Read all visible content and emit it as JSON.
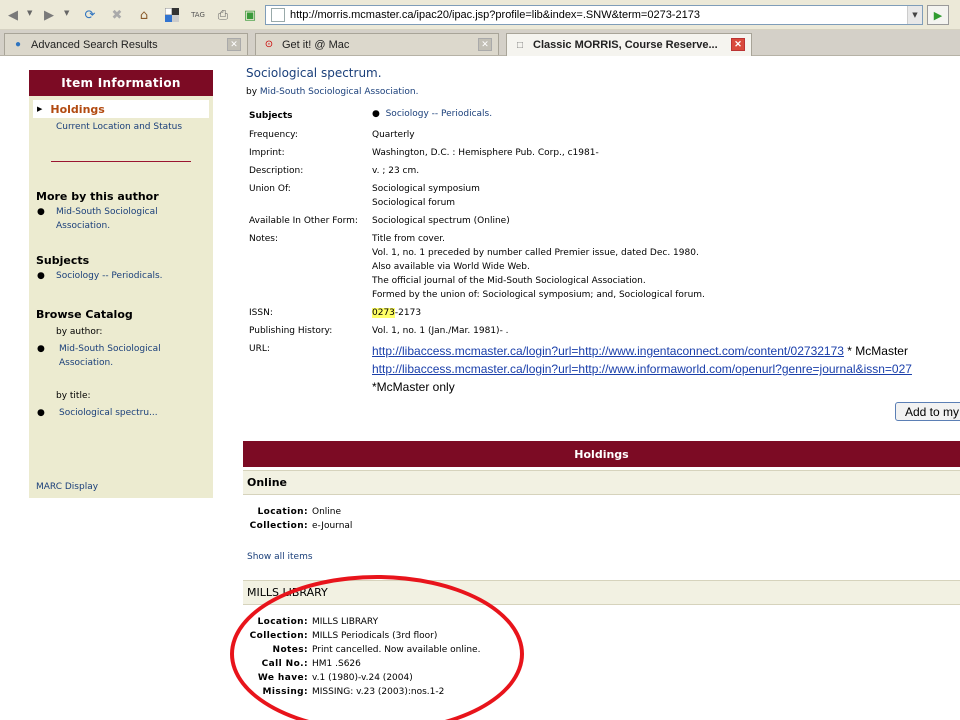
{
  "browser": {
    "address": "http://morris.mcmaster.ca/ipac20/ipac.jsp?profile=lib&index=.SNW&term=0273-2173",
    "tabs": [
      {
        "label": "Advanced Search Results"
      },
      {
        "label": "Get it! @ Mac"
      },
      {
        "label": "Classic MORRIS, Course Reserve..."
      }
    ],
    "toolbar_icons": [
      "back-icon",
      "forward-icon",
      "refresh-icon",
      "stop-icon",
      "home-icon",
      "delicious-icon",
      "tag-icon",
      "print-icon",
      "new-tab-icon"
    ]
  },
  "sidebar": {
    "header": "Item Information",
    "holdings": "Holdings",
    "current_location": "Current Location and Status",
    "more_by_author": "More by this author",
    "author_link_1": "Mid-South Sociological",
    "author_link_2": "Association.",
    "subjects_title": "Subjects",
    "subjects_link": "Sociology -- Periodicals.",
    "browse_title": "Browse Catalog",
    "by_author": "by author:",
    "browse_author_1": "Mid-South Sociological",
    "browse_author_2": "Association.",
    "by_title": "by title:",
    "browse_title_link": "Sociological spectru...",
    "marc": "MARC Display"
  },
  "record": {
    "title": "Sociological spectrum.",
    "by_prefix": "by",
    "by_link": "Mid-South Sociological Association.",
    "subjects_label": "Subjects",
    "subjects_value": "Sociology -- Periodicals.",
    "frequency_label": "Frequency:",
    "frequency_value": "Quarterly",
    "imprint_label": "Imprint:",
    "imprint_value": "Washington, D.C. : Hemisphere Pub. Corp., c1981-",
    "description_label": "Description:",
    "description_value": "v. ; 23 cm.",
    "union_label": "Union Of:",
    "union_1": "Sociological symposium",
    "union_2": "Sociological forum",
    "available_label": "Available In Other Form:",
    "available_value": "Sociological spectrum (Online)",
    "notes_label": "Notes:",
    "notes_1": "Title from cover.",
    "notes_2": "Vol. 1, no. 1 preceded by number called Premier issue, dated Dec. 1980.",
    "notes_3": "Also available via World Wide Web.",
    "notes_4": "The official journal of the Mid-South Sociological Association.",
    "notes_5": "Formed by the union of: Sociological symposium; and, Sociological forum.",
    "issn_label": "ISSN:",
    "issn_highlight": "0273",
    "issn_rest": "-2173",
    "pubhist_label": "Publishing History:",
    "pubhist_value": "Vol. 1, no. 1 (Jan./Mar. 1981)- .",
    "url_label": "URL:",
    "url_1": "http://libaccess.mcmaster.ca/login?url=http://www.ingentaconnect.com/content/02732173",
    "url_1_suffix": " * McMaster",
    "url_2": "http://libaccess.mcmaster.ca/login?url=http://www.informaworld.com/openurl?genre=journal&issn=027",
    "url_3": "*McMaster only",
    "add_button": "Add to my"
  },
  "holdings": {
    "bar": "Holdings",
    "online_head": "Online",
    "online_location_label": "Location:",
    "online_location": "Online",
    "online_collection_label": "Collection:",
    "online_collection": "e-Journal",
    "show_all": "Show all items",
    "mills_head": "MILLS LIBRARY",
    "m_location_label": "Location:",
    "m_location": "MILLS LIBRARY",
    "m_collection_label": "Collection:",
    "m_collection": "MILLS Periodicals (3rd floor)",
    "m_notes_label": "Notes:",
    "m_notes": "Print cancelled. Now available online.",
    "m_callno_label": "Call No.:",
    "m_callno": "HM1 .S626",
    "m_wehave_label": "We have:",
    "m_wehave": "v.1 (1980)-v.24 (2004)",
    "m_missing_label": "Missing:",
    "m_missing": "MISSING: v.23 (2003):nos.1-2"
  },
  "colors": {
    "header_maroon": "#7c0b24",
    "sidebar_bg": "#ecebd0",
    "link_blue": "#1a3f7a",
    "annotation_red": "#e8141b"
  }
}
